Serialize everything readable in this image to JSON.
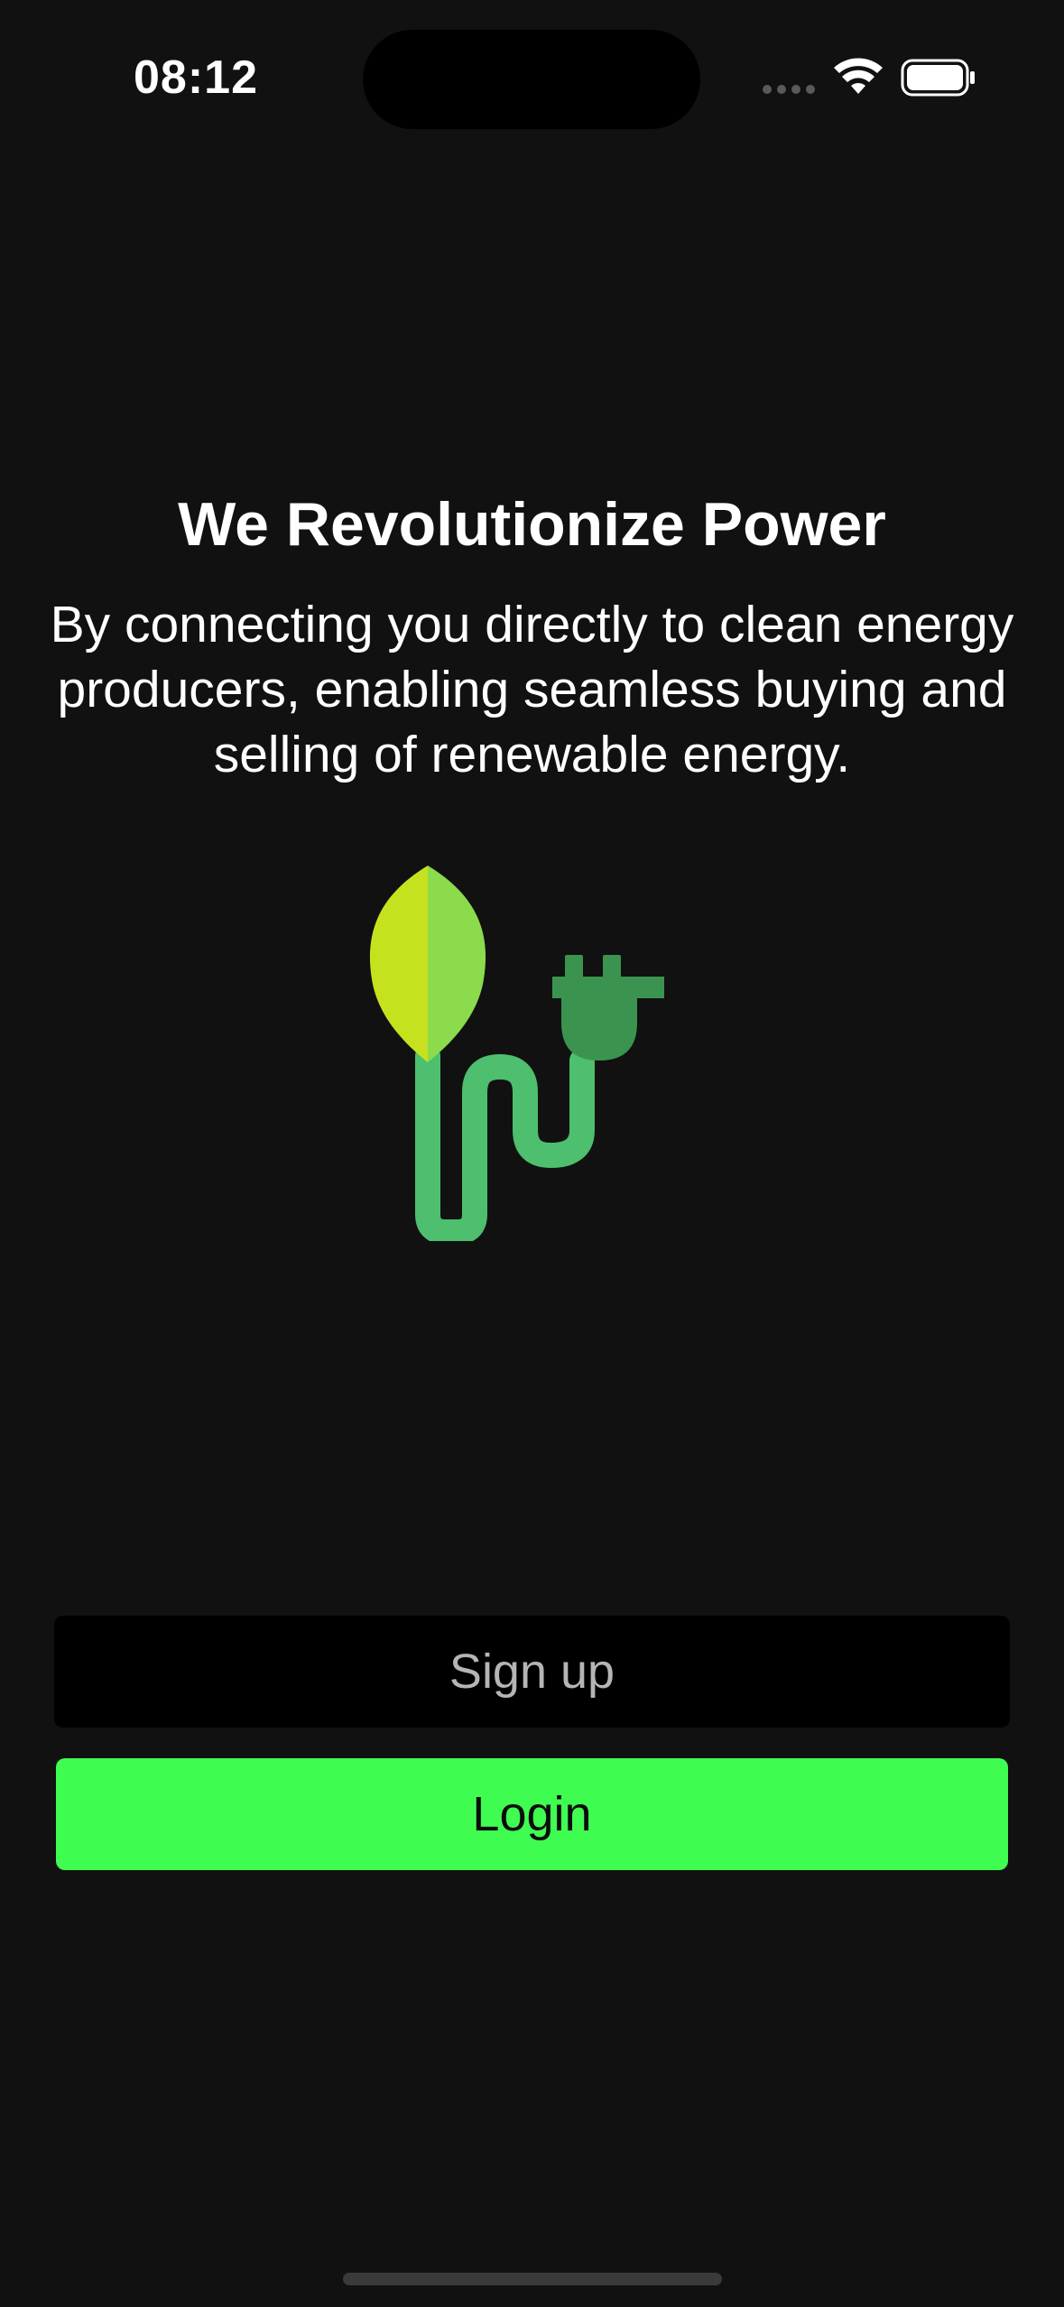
{
  "status_bar": {
    "time": "08:12",
    "icons": [
      "cellular-signal-icon",
      "wifi-icon",
      "battery-icon"
    ]
  },
  "onboarding": {
    "headline": "We Revolutionize Power",
    "subtitle": "By connecting you directly to clean energy producers, enabling seamless buying and selling of renewable energy.",
    "illustration": "leaf-plug-icon"
  },
  "actions": {
    "signup_label": "Sign up",
    "login_label": "Login"
  },
  "colors": {
    "background": "#111111",
    "login_accent": "#3ffc51",
    "signup_background": "#000000",
    "leaf_light": "#c6e21e",
    "leaf_dark": "#8bdb4c",
    "cable": "#4dbf6e",
    "plug": "#3a9450"
  }
}
